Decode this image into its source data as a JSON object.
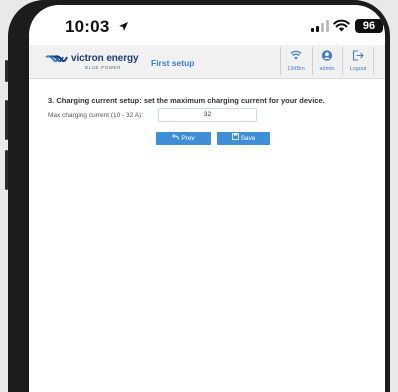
{
  "status_bar": {
    "time": "10:03",
    "battery": "96"
  },
  "header": {
    "brand": "victron energy",
    "brand_sub": "BLUE POWER",
    "page_title": "First setup",
    "buttons": [
      {
        "label": "19dBm",
        "icon": "wifi-signal-icon"
      },
      {
        "label": "admin",
        "icon": "user-icon"
      },
      {
        "label": "Logout",
        "icon": "logout-icon"
      }
    ]
  },
  "form": {
    "section_title": "3. Charging current setup: set the maximum charging current for your device.",
    "field_label": "Max charging current (10 - 32 A):",
    "field_value": "32",
    "prev_label": "Prev",
    "save_label": "Save"
  },
  "colors": {
    "accent": "#3f8ed8",
    "title_blue": "#3b7fd0",
    "brand_navy": "#1f3d6e"
  }
}
